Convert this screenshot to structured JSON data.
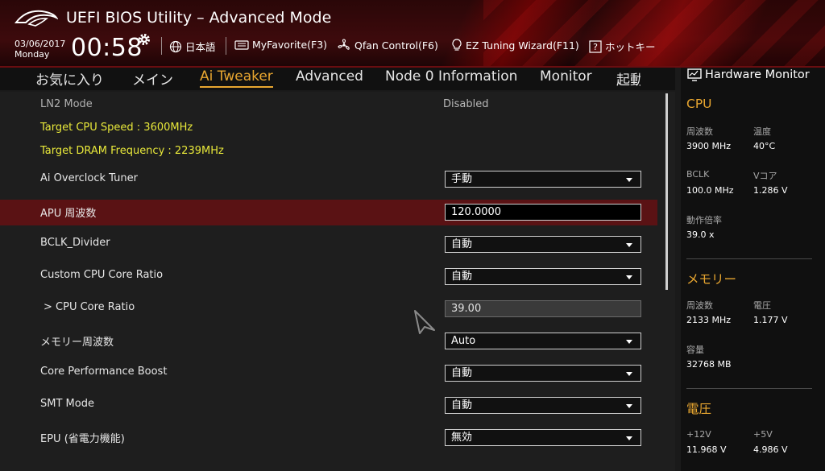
{
  "app": {
    "title": "UEFI BIOS Utility – Advanced Mode",
    "date": "03/06/2017",
    "day": "Monday",
    "time": "00:58"
  },
  "toolbar": {
    "language": "日本語",
    "myfavorite": "MyFavorite(F3)",
    "qfan": "Qfan Control(F6)",
    "ez_tuning": "EZ Tuning Wizard(F11)",
    "hotkeys": "ホットキー"
  },
  "tabs": [
    {
      "label": "お気に入り"
    },
    {
      "label": "メイン"
    },
    {
      "label": "Ai Tweaker",
      "active": true
    },
    {
      "label": "Advanced"
    },
    {
      "label": "Node 0 Information"
    },
    {
      "label": "Monitor"
    },
    {
      "label": "起動"
    }
  ],
  "settings": {
    "ln2_mode": {
      "label": "LN2 Mode",
      "value": "Disabled"
    },
    "target_cpu_speed": "Target CPU Speed : 3600MHz",
    "target_dram_freq": "Target DRAM Frequency : 2239MHz",
    "rows": [
      {
        "label": "Ai Overclock Tuner",
        "value": "手動",
        "type": "dropdown"
      },
      {
        "label": "APU 周波数",
        "value": "120.0000",
        "type": "text",
        "selected": true
      },
      {
        "label": "BCLK_Divider",
        "value": "自動",
        "type": "dropdown"
      },
      {
        "label": "Custom CPU Core Ratio",
        "value": "自動",
        "type": "dropdown"
      },
      {
        "label": " > CPU Core Ratio",
        "value": "39.00",
        "type": "readonly"
      },
      {
        "label": "メモリー周波数",
        "value": "Auto",
        "type": "dropdown"
      },
      {
        "label": "Core Performance Boost",
        "value": "自動",
        "type": "dropdown"
      },
      {
        "label": "SMT Mode",
        "value": "自動",
        "type": "dropdown"
      },
      {
        "label": "EPU (省電力機能)",
        "value": "無効",
        "type": "dropdown"
      }
    ]
  },
  "hardware_monitor": {
    "title": "Hardware Monitor",
    "cpu": {
      "heading": "CPU",
      "freq_label": "周波数",
      "freq_value": "3900 MHz",
      "temp_label": "温度",
      "temp_value": "40°C",
      "bclk_label": "BCLK",
      "bclk_value": "100.0 MHz",
      "vcore_label": "Vコア",
      "vcore_value": "1.286 V",
      "ratio_label": "動作倍率",
      "ratio_value": "39.0 x"
    },
    "memory": {
      "heading": "メモリー",
      "freq_label": "周波数",
      "freq_value": "2133 MHz",
      "volt_label": "電圧",
      "volt_value": "1.177 V",
      "cap_label": "容量",
      "cap_value": "32768 MB"
    },
    "voltage": {
      "heading": "電圧",
      "v12_label": "+12V",
      "v12_value": "11.968 V",
      "v5_label": "+5V",
      "v5_value": "4.986 V"
    }
  },
  "colors": {
    "accent": "#e8a630",
    "highlight_yellow": "#e8e83a",
    "selected_row": "#5a1214",
    "header_red": "#3d0a0c"
  }
}
